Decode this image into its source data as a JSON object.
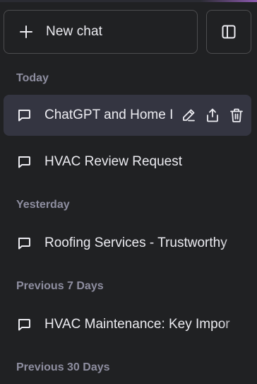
{
  "sidebar": {
    "new_chat_label": "New chat",
    "sections": [
      {
        "title": "Today",
        "items": [
          {
            "title": "ChatGPT and Home I",
            "active": true
          },
          {
            "title": "HVAC Review Request",
            "active": false
          }
        ]
      },
      {
        "title": "Yesterday",
        "items": [
          {
            "title": "Roofing Services - Trustworthy",
            "active": false
          }
        ]
      },
      {
        "title": "Previous 7 Days",
        "items": [
          {
            "title": "HVAC Maintenance: Key Impor",
            "active": false
          }
        ]
      },
      {
        "title": "Previous 30 Days",
        "items": []
      }
    ]
  },
  "icons": {
    "new_chat": "plus-icon",
    "toggle_sidebar": "sidebar-toggle-icon",
    "chat": "chat-bubble-icon",
    "edit": "pencil-icon",
    "share": "share-icon",
    "delete": "trash-icon"
  },
  "colors": {
    "background": "#202123",
    "active_item": "#343541",
    "text": "#ececf1",
    "section_title": "#8e8ea0",
    "border": "#4d4d4f"
  }
}
